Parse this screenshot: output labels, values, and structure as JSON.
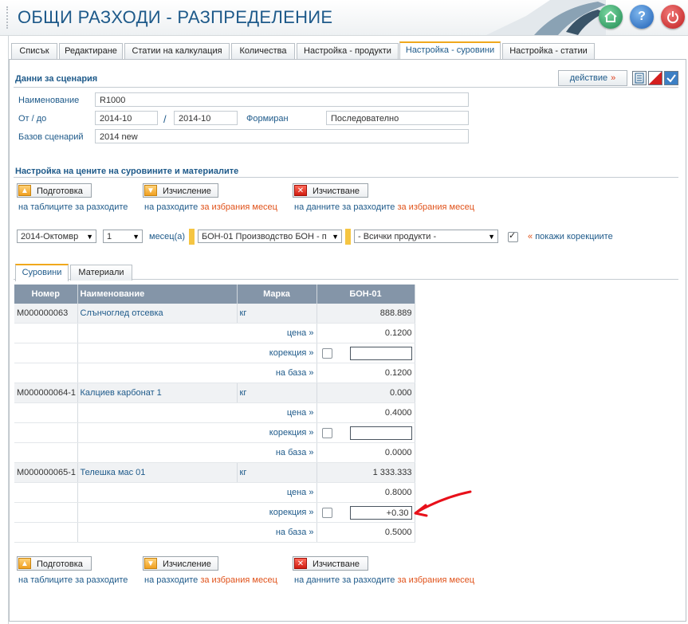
{
  "app": {
    "title": "ОБЩИ РАЗХОДИ - РАЗПРЕДЕЛЕНИЕ"
  },
  "header_icons": [
    "home-icon",
    "help-icon",
    "power-icon"
  ],
  "tabs": [
    "Списък",
    "Редактиране",
    "Статии на калкулация",
    "Количества",
    "Настройка - продукти",
    "Настройка - суровини",
    "Настройка - статии"
  ],
  "active_tab": "Настройка - суровини",
  "scenario": {
    "section_title": "Данни за сценария",
    "action_label": "действие",
    "action_chevron": "»",
    "name_label": "Наименование",
    "name_value": "R1000",
    "from_to_label": "От / до",
    "from_value": "2014-10",
    "separator": "/",
    "to_value": "2014-10",
    "formed_label": "Формиран",
    "formed_value": "Последователно",
    "base_label": "Базов сценарий",
    "base_value": "2014 new"
  },
  "prices": {
    "section_title": "Настройка на цените на суровините и материалите",
    "buttons": {
      "prepare": "Подготовка",
      "calculate": "Изчисление",
      "clear": "Изчистване"
    },
    "captions": {
      "prepare": "на таблиците за разходите",
      "calculate_a": "на разходите",
      "calculate_b": "за избрания месец",
      "clear_a": "на данните за разходите",
      "clear_b": "за избрания месец"
    }
  },
  "filters": {
    "month": "2014-Октомвр",
    "count": "1",
    "months_label": "месец(а)",
    "production": "БОН-01 Производство БОН - п",
    "products": "- Всички продукти -",
    "show_corrections_checked": true,
    "show_corrections_label": "покажи корекциите",
    "show_corrections_chevron": "«"
  },
  "subtabs": [
    "Суровини",
    "Материали"
  ],
  "table": {
    "headers": [
      "Номер",
      "Наименование",
      "Марка",
      "БОН-01"
    ],
    "sub_labels": {
      "price": "цена",
      "correction": "корекция",
      "base": "на база",
      "chevron": "»"
    },
    "items": [
      {
        "code": "M000000063",
        "name": "Слънчоглед отсевка",
        "unit": "кг",
        "qty": "888.889",
        "price": "0.1200",
        "correction": "",
        "base": "0.1200"
      },
      {
        "code": "M000000064-1",
        "name": "Калциев карбонат 1",
        "unit": "кг",
        "qty": "0.000",
        "price": "0.4000",
        "correction": "",
        "base": "0.0000"
      },
      {
        "code": "M000000065-1",
        "name": "Телешка мас 01",
        "unit": "кг",
        "qty": "1 333.333",
        "price": "0.8000",
        "correction": "+0.30",
        "base": "0.5000"
      }
    ]
  },
  "colors": {
    "accent": "#1e5a8a",
    "header_row": "#8495a8",
    "highlight": "#e0521a",
    "tab_active": "#f0a81c"
  }
}
